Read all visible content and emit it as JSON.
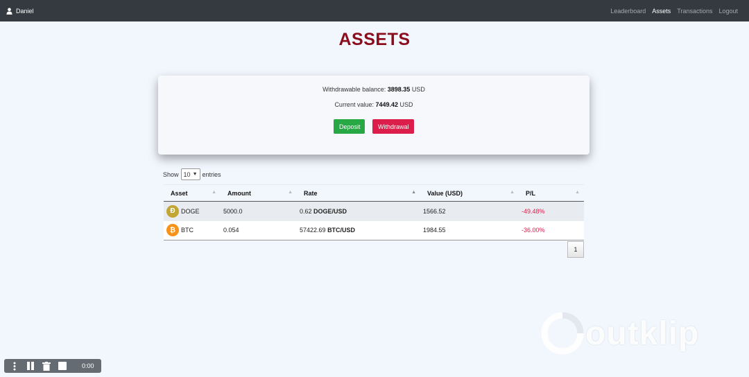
{
  "navbar": {
    "user_name": "Daniel",
    "links": [
      {
        "label": "Leaderboard",
        "active": false
      },
      {
        "label": "Assets",
        "active": true
      },
      {
        "label": "Transactions",
        "active": false
      },
      {
        "label": "Logout",
        "active": false
      }
    ]
  },
  "page": {
    "title": "ASSETS"
  },
  "balance": {
    "withdrawable_label": "Withdrawable balance:",
    "withdrawable_value": "3898.35",
    "withdrawable_unit": "USD",
    "current_label": "Current value:",
    "current_value": "7449.42",
    "current_unit": "USD",
    "deposit_label": "Deposit",
    "withdrawal_label": "Withdrawal"
  },
  "table_controls": {
    "show_label": "Show",
    "entries_value": "10",
    "entries_label": "entries"
  },
  "table": {
    "columns": [
      "Asset",
      "Amount",
      "Rate",
      "Value (USD)",
      "P/L"
    ],
    "rows": [
      {
        "asset": "DOGE",
        "amount": "5000.0",
        "rate": "0.62",
        "pair": "DOGE/USD",
        "value": "1566.52",
        "pl": "-49.48%"
      },
      {
        "asset": "BTC",
        "amount": "0.054",
        "rate": "57422.69",
        "pair": "BTC/USD",
        "value": "1984.55",
        "pl": "-36.00%"
      }
    ]
  },
  "pagination": {
    "current_page": "1"
  },
  "watermark": {
    "text": "outklip"
  },
  "recorder": {
    "time": "0:00"
  },
  "colors": {
    "navbar": "#343a40",
    "title": "#8b0e1d",
    "deposit": "#28a745",
    "withdrawal": "#dc1e4a",
    "negative": "#dc1e4a"
  }
}
